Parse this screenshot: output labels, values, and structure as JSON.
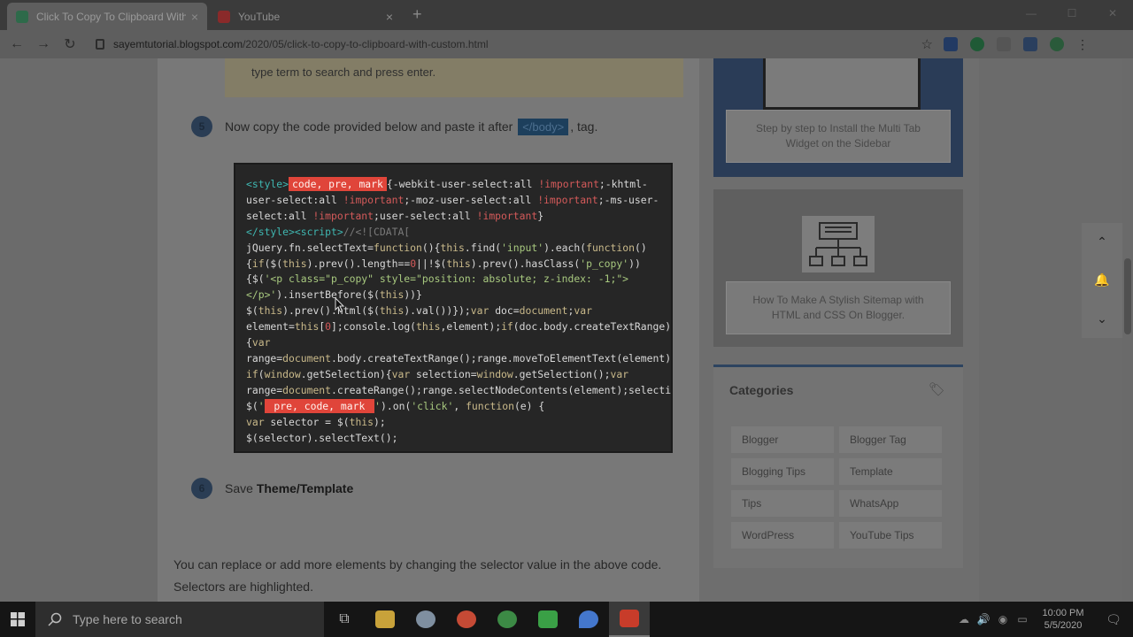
{
  "browser": {
    "tabs": [
      {
        "title": "Click To Copy To Clipboard With",
        "close": "×"
      },
      {
        "title": "YouTube",
        "close": "×"
      }
    ],
    "new_tab": "+",
    "url_host": "sayemtutorial.blogspot.com",
    "url_path": "/2020/05/click-to-copy-to-clipboard-with-custom.html"
  },
  "article": {
    "note_text": "type term to search and press enter.",
    "step5": {
      "num": "5",
      "text_before": "Now copy the code provided below and paste it after",
      "chip": "</body>",
      "text_after": ", tag."
    },
    "code_lines": [
      [
        {
          "c": "tk-t",
          "t": "<style>"
        },
        {
          "c": "hl",
          "t": "code, pre, mark"
        },
        {
          "c": "",
          "t": "{-webkit-user-select:all "
        },
        {
          "c": "tk-r",
          "t": "!important"
        },
        {
          "c": "",
          "t": ";-khtml-"
        }
      ],
      [
        {
          "c": "",
          "t": "user-select:all "
        },
        {
          "c": "tk-r",
          "t": "!important"
        },
        {
          "c": "",
          "t": ";-moz-user-select:all "
        },
        {
          "c": "tk-r",
          "t": "!important"
        },
        {
          "c": "",
          "t": ";-ms-user-"
        }
      ],
      [
        {
          "c": "",
          "t": "select:all "
        },
        {
          "c": "tk-r",
          "t": "!important"
        },
        {
          "c": "",
          "t": ";user-select:all "
        },
        {
          "c": "tk-r",
          "t": "!important"
        },
        {
          "c": "",
          "t": "}"
        }
      ],
      [
        {
          "c": "tk-t",
          "t": "</style><script>"
        },
        {
          "c": "tk-c",
          "t": "//<![CDATA["
        }
      ],
      [
        {
          "c": "",
          "t": "jQuery.fn.selectText="
        },
        {
          "c": "tk-k",
          "t": "function"
        },
        {
          "c": "",
          "t": "(){"
        },
        {
          "c": "tk-k",
          "t": "this"
        },
        {
          "c": "",
          "t": ".find("
        },
        {
          "c": "tk-s",
          "t": "'input'"
        },
        {
          "c": "",
          "t": ").each("
        },
        {
          "c": "tk-k",
          "t": "function"
        },
        {
          "c": "",
          "t": "()"
        }
      ],
      [
        {
          "c": "",
          "t": "{"
        },
        {
          "c": "tk-k",
          "t": "if"
        },
        {
          "c": "",
          "t": "($("
        },
        {
          "c": "tk-k",
          "t": "this"
        },
        {
          "c": "",
          "t": ").prev().length=="
        },
        {
          "c": "tk-r",
          "t": "0"
        },
        {
          "c": "",
          "t": "||!$("
        },
        {
          "c": "tk-k",
          "t": "this"
        },
        {
          "c": "",
          "t": ").prev().hasClass("
        },
        {
          "c": "tk-s",
          "t": "'p_copy'"
        },
        {
          "c": "",
          "t": "))"
        }
      ],
      [
        {
          "c": "",
          "t": "{$("
        },
        {
          "c": "tk-s",
          "t": "'<p class=\"p_copy\" style=\"position: absolute; z-index: -1;\">"
        }
      ],
      [
        {
          "c": "tk-s",
          "t": "</p>'"
        },
        {
          "c": "",
          "t": ").insertBefore($("
        },
        {
          "c": "tk-k",
          "t": "this"
        },
        {
          "c": "",
          "t": "))}"
        }
      ],
      [
        {
          "c": "",
          "t": "$("
        },
        {
          "c": "tk-k",
          "t": "this"
        },
        {
          "c": "",
          "t": ").prev().html($("
        },
        {
          "c": "tk-k",
          "t": "this"
        },
        {
          "c": "",
          "t": ").val())});"
        },
        {
          "c": "tk-k",
          "t": "var"
        },
        {
          "c": "",
          "t": " doc="
        },
        {
          "c": "tk-k",
          "t": "document"
        },
        {
          "c": "",
          "t": ";"
        },
        {
          "c": "tk-k",
          "t": "var"
        }
      ],
      [
        {
          "c": "",
          "t": "element="
        },
        {
          "c": "tk-k",
          "t": "this"
        },
        {
          "c": "",
          "t": "["
        },
        {
          "c": "tk-r",
          "t": "0"
        },
        {
          "c": "",
          "t": "];console.log("
        },
        {
          "c": "tk-k",
          "t": "this"
        },
        {
          "c": "",
          "t": ",element);"
        },
        {
          "c": "tk-k",
          "t": "if"
        },
        {
          "c": "",
          "t": "(doc.body.createTextRange)"
        }
      ],
      [
        {
          "c": "",
          "t": "{"
        },
        {
          "c": "tk-k",
          "t": "var"
        }
      ],
      [
        {
          "c": "",
          "t": "range="
        },
        {
          "c": "tk-k",
          "t": "document"
        },
        {
          "c": "",
          "t": ".body.createTextRange();range.moveToElementText(element);ra"
        }
      ],
      [
        {
          "c": "tk-k",
          "t": "if"
        },
        {
          "c": "",
          "t": "("
        },
        {
          "c": "tk-k",
          "t": "window"
        },
        {
          "c": "",
          "t": ".getSelection){"
        },
        {
          "c": "tk-k",
          "t": "var"
        },
        {
          "c": "",
          "t": " selection="
        },
        {
          "c": "tk-k",
          "t": "window"
        },
        {
          "c": "",
          "t": ".getSelection();"
        },
        {
          "c": "tk-k",
          "t": "var"
        }
      ],
      [
        {
          "c": "",
          "t": "range="
        },
        {
          "c": "tk-k",
          "t": "document"
        },
        {
          "c": "",
          "t": ".createRange();range.selectNodeContents(element);selection."
        }
      ],
      [
        {
          "c": "",
          "t": "$("
        },
        {
          "c": "tk-s",
          "t": "'"
        },
        {
          "c": "hl",
          "t": " pre, code, mark "
        },
        {
          "c": "tk-s",
          "t": "'"
        },
        {
          "c": "",
          "t": ").on("
        },
        {
          "c": "tk-s",
          "t": "'click'"
        },
        {
          "c": "",
          "t": ", "
        },
        {
          "c": "tk-k",
          "t": "function"
        },
        {
          "c": "",
          "t": "(e) {"
        }
      ],
      [
        {
          "c": "tk-k",
          "t": "var"
        },
        {
          "c": "",
          "t": " selector = $("
        },
        {
          "c": "tk-k",
          "t": "this"
        },
        {
          "c": "",
          "t": ");"
        }
      ],
      [
        {
          "c": "",
          "t": "$(selector).selectText();"
        }
      ]
    ],
    "step6": {
      "num": "6",
      "text_before": "Save ",
      "bold": "Theme/Template"
    },
    "paragraph": "You can replace or add more elements by changing the selector value in the above code. Selectors are highlighted."
  },
  "sidebar": {
    "card1_caption": "Step by step to Install the Multi Tab Widget on the Sidebar",
    "card2_caption": "How To Make A Stylish Sitemap with HTML and CSS On Blogger.",
    "categories_title": "Categories",
    "categories": [
      "Blogger",
      "Blogger Tag",
      "Blogging Tips",
      "Template",
      "Tips",
      "WhatsApp",
      "WordPress",
      "YouTube Tips"
    ]
  },
  "taskbar": {
    "search_placeholder": "Type here to search",
    "time": "10:00 PM",
    "date": "5/5/2020"
  },
  "icons": {
    "back": "arrow-left-icon",
    "forward": "arrow-right-icon",
    "reload": "reload-icon",
    "star": "star-icon",
    "windows": "windows-logo-icon",
    "search": "search-icon",
    "up": "chevron-up-icon",
    "bell": "bell-icon",
    "down": "chevron-down-icon",
    "tag": "tag-icon"
  }
}
